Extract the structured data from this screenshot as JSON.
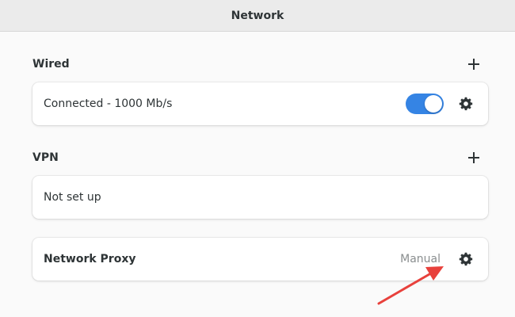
{
  "window": {
    "title": "Network"
  },
  "wired": {
    "section_title": "Wired",
    "add_icon": "plus-icon",
    "row": {
      "label": "Connected - 1000 Mb/s",
      "toggle_on": true,
      "settings_icon": "gear-icon"
    }
  },
  "vpn": {
    "section_title": "VPN",
    "add_icon": "plus-icon",
    "row": {
      "label": "Not set up"
    }
  },
  "proxy": {
    "row": {
      "label": "Network Proxy",
      "value": "Manual",
      "settings_icon": "gear-icon"
    }
  },
  "colors": {
    "accent": "#3584e4",
    "annotation_arrow": "#e8413c"
  }
}
